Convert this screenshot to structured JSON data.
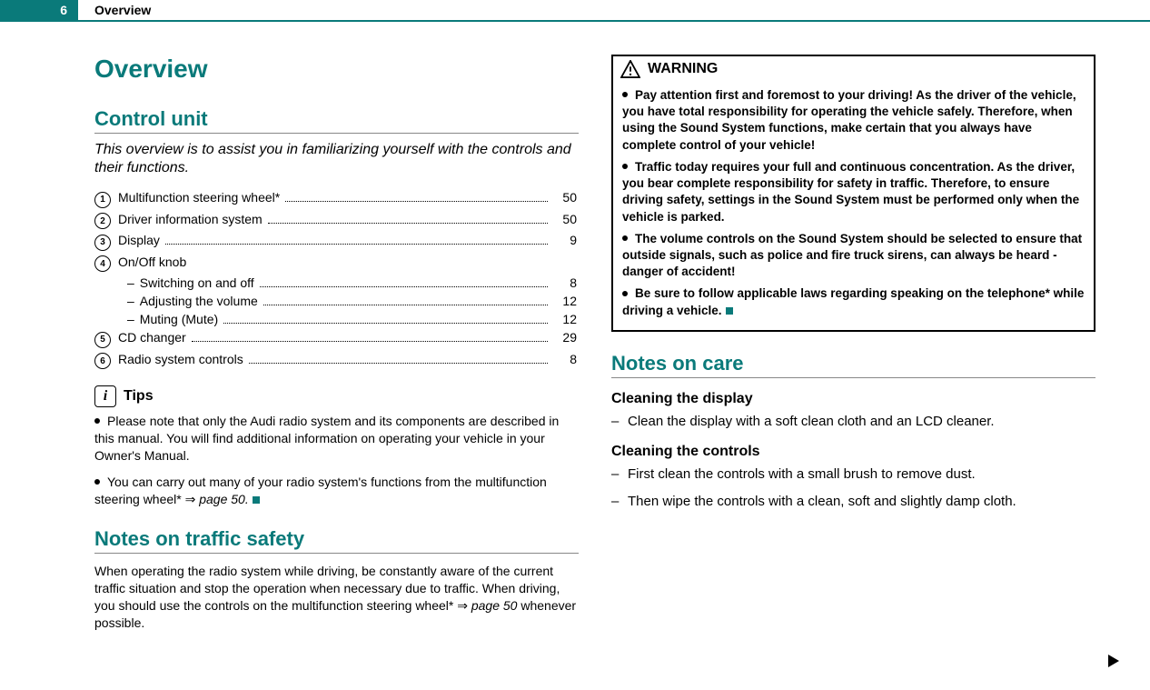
{
  "header": {
    "page_number": "6",
    "title": "Overview"
  },
  "left": {
    "main_heading": "Overview",
    "control_unit": {
      "heading": "Control unit",
      "intro": "This overview is to assist you in familiarizing yourself with the controls and their functions.",
      "items": [
        {
          "num": "1",
          "label": "Multifunction steering wheel*",
          "page": "50"
        },
        {
          "num": "2",
          "label": "Driver information system",
          "page": "50"
        },
        {
          "num": "3",
          "label": "Display",
          "page": "9"
        },
        {
          "num": "4",
          "label": "On/Off knob",
          "page": "",
          "subs": [
            {
              "label": "Switching on and off",
              "page": "8"
            },
            {
              "label": "Adjusting the volume",
              "page": "12"
            },
            {
              "label": "Muting (Mute)",
              "page": "12"
            }
          ]
        },
        {
          "num": "5",
          "label": "CD changer",
          "page": "29"
        },
        {
          "num": "6",
          "label": "Radio system controls",
          "page": "8"
        }
      ]
    },
    "tips": {
      "label": "Tips",
      "bullets": [
        "Please note that only the Audi radio system and its components are described in this manual. You will find additional information on operating your vehicle in your Owner's Manual.",
        "You can carry out many of your radio system's functions from the multifunction steering wheel* ⇒ "
      ],
      "page_ref": "page 50."
    },
    "traffic_safety": {
      "heading": "Notes on traffic safety",
      "para_pre": "When operating the radio system while driving, be constantly aware of the current traffic situation and stop the operation when necessary due to traffic. When driving, you should use the controls on the multifunction steering wheel* ⇒ ",
      "page_ref": "page 50",
      "para_post": " whenever possible."
    }
  },
  "right": {
    "warning": {
      "title": "WARNING",
      "bullets": [
        "Pay attention first and foremost to your driving! As the driver of the vehicle, you have total responsibility for operating the vehicle safely. Therefore, when using the Sound System functions, make certain that you always have complete control of your vehicle!",
        "Traffic today requires your full and continuous concentration. As the driver, you bear complete responsibility for safety in traffic. Therefore, to ensure driving safety, settings in the Sound System must be performed only when the vehicle is parked.",
        "The volume controls on the Sound System should be selected to ensure that outside signals, such as police and fire truck sirens, can always be heard - danger of accident!",
        "Be sure to follow applicable laws regarding speaking on the telephone* while driving a vehicle."
      ]
    },
    "care": {
      "heading": "Notes on care",
      "sub1": {
        "heading": "Cleaning the display",
        "items": [
          "Clean the display with a soft clean cloth and an LCD cleaner."
        ]
      },
      "sub2": {
        "heading": "Cleaning the controls",
        "items": [
          "First clean the controls with a small brush to remove dust.",
          "Then wipe the controls with a clean, soft and slightly damp cloth."
        ]
      }
    }
  }
}
